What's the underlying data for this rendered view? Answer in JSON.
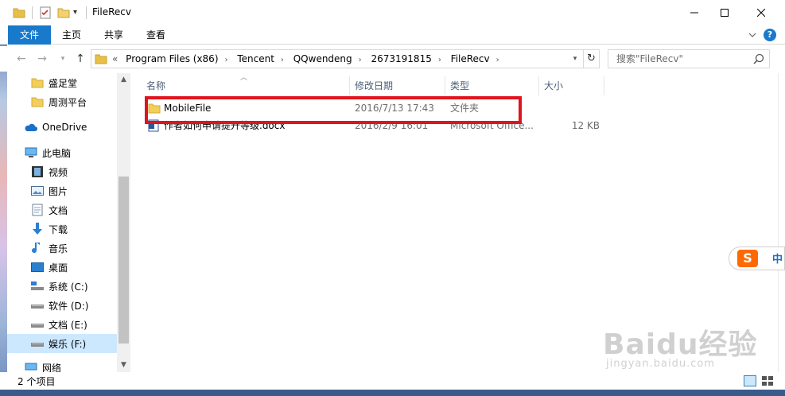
{
  "window": {
    "title": "FileRecv"
  },
  "ribbon": {
    "tabs": [
      {
        "label": "文件",
        "active": true
      },
      {
        "label": "主页"
      },
      {
        "label": "共享"
      },
      {
        "label": "查看"
      }
    ],
    "help_label": "?"
  },
  "address": {
    "breadcrumbs": [
      "Program Files (x86)",
      "Tencent",
      "QQwendeng",
      "2673191815",
      "FileRecv"
    ],
    "overflow": "«"
  },
  "search": {
    "placeholder": "搜索\"FileRecv\""
  },
  "nav": {
    "items": [
      {
        "label": "盛足堂",
        "icon": "folder-icon"
      },
      {
        "label": "周测平台",
        "icon": "folder-icon"
      },
      {
        "label": "OneDrive",
        "icon": "cloud-icon"
      },
      {
        "label": "此电脑",
        "icon": "pc-icon"
      },
      {
        "label": "视频",
        "icon": "video-icon"
      },
      {
        "label": "图片",
        "icon": "pictures-icon"
      },
      {
        "label": "文档",
        "icon": "document-icon"
      },
      {
        "label": "下载",
        "icon": "download-icon"
      },
      {
        "label": "音乐",
        "icon": "music-icon"
      },
      {
        "label": "桌面",
        "icon": "desktop-icon"
      },
      {
        "label": "系统 (C:)",
        "icon": "drive-icon"
      },
      {
        "label": "软件 (D:)",
        "icon": "drive-icon"
      },
      {
        "label": "文档 (E:)",
        "icon": "drive-icon"
      },
      {
        "label": "娱乐 (F:)",
        "icon": "drive-icon",
        "selected": true
      },
      {
        "label": "网络",
        "icon": "network-icon"
      }
    ]
  },
  "list": {
    "columns": [
      "名称",
      "修改日期",
      "类型",
      "大小"
    ],
    "rows": [
      {
        "name": "MobileFile",
        "date": "2016/7/13 17:43",
        "type": "文件夹",
        "size": "",
        "icon": "folder-icon"
      },
      {
        "name": "作者如何申请提升等级.docx",
        "date": "2016/2/9 16:01",
        "type": "Microsoft Office...",
        "size": "12 KB",
        "icon": "word-doc-icon"
      }
    ]
  },
  "status": {
    "item_count": "2 个项目"
  },
  "ime": {
    "logo": "S",
    "lang": "中"
  },
  "watermark": {
    "logo": "Baidu经验",
    "url": "jingyan.baidu.com"
  },
  "colors": {
    "accent": "#1979ca",
    "highlight_box": "#e0141e",
    "selection": "#cce8ff"
  }
}
